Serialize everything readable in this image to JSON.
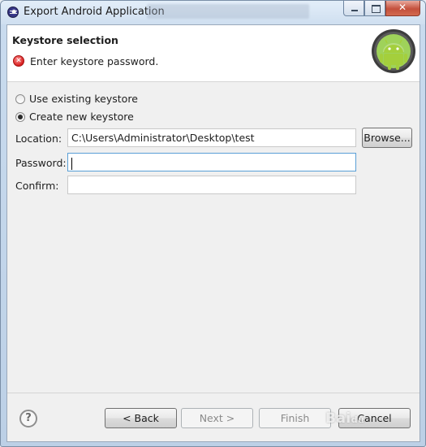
{
  "window": {
    "title": "Export Android Application",
    "title_ghost": "nnel String"
  },
  "header": {
    "title": "Keystore selection",
    "message": "Enter keystore password.",
    "error_icon": "error-icon",
    "logo": "android-logo"
  },
  "options": {
    "use_existing": {
      "label": "Use existing keystore",
      "checked": false
    },
    "create_new": {
      "label": "Create new keystore",
      "checked": true
    }
  },
  "fields": {
    "location": {
      "label": "Location:",
      "value": "C:\\Users\\Administrator\\Desktop\\test"
    },
    "password": {
      "label": "Password:",
      "value": ""
    },
    "confirm": {
      "label": "Confirm:",
      "value": ""
    }
  },
  "buttons": {
    "browse": "Browse...",
    "back": "< Back",
    "next": "Next >",
    "finish": "Finish",
    "cancel": "Cancel"
  },
  "help_icon": "?",
  "watermark": "Baidu",
  "colors": {
    "accent_focus": "#5a9fd6",
    "error": "#d61f1f",
    "android_green": "#8cc63f"
  }
}
